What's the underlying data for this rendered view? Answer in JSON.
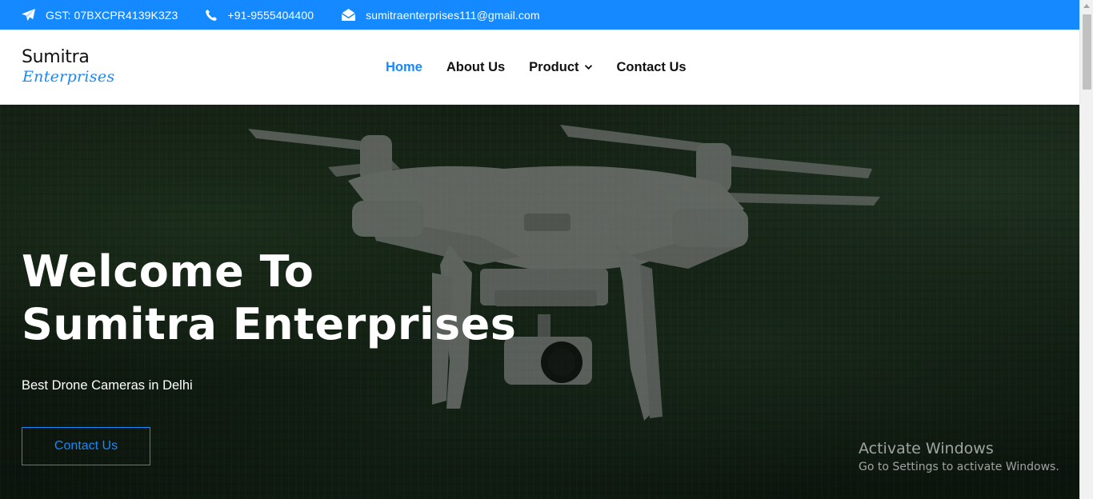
{
  "topbar": {
    "gst": "GST: 07BXCPR4139K3Z3",
    "phone": "+91-9555404400",
    "email": "sumitraenterprises111@gmail.com",
    "bg_color": "#1589ff",
    "icons": [
      "paper-plane-icon",
      "phone-icon",
      "envelope-open-icon"
    ]
  },
  "logo": {
    "line1": "Sumitra",
    "line2": "Enterprises",
    "accent_color": "#1589ff"
  },
  "nav": {
    "items": [
      {
        "label": "Home",
        "active": true
      },
      {
        "label": "About Us",
        "active": false
      },
      {
        "label": "Product",
        "active": false,
        "dropdown": true
      },
      {
        "label": "Contact Us",
        "active": false
      }
    ]
  },
  "hero": {
    "title_line1": "Welcome To",
    "title_line2": "Sumitra Enterprises",
    "subtitle": "Best Drone Cameras in Delhi",
    "cta_label": "Contact Us"
  },
  "watermark": {
    "title": "Activate Windows",
    "subtitle": "Go to Settings to activate Windows."
  }
}
